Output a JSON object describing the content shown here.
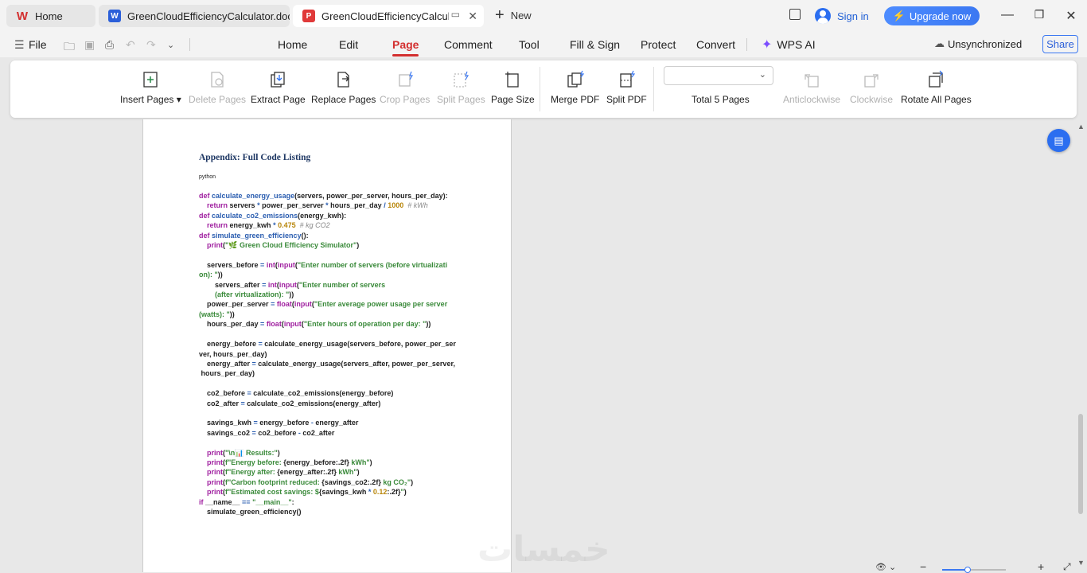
{
  "tabs": [
    {
      "label": "Home",
      "icon": "wps-logo-icon",
      "color": "#d32f2f"
    },
    {
      "label": "GreenCloudEfficiencyCalculator.doc",
      "icon": "word-doc-icon",
      "color": "#2b5fd9"
    },
    {
      "label": "GreenCloudEfficiencyCalcula",
      "icon": "pdf-doc-icon",
      "color": "#e03a3a"
    }
  ],
  "new_tab_label": "New",
  "sign_in_label": "Sign in",
  "upgrade_label": "Upgrade now",
  "menu": {
    "file": "File",
    "items": [
      "Home",
      "Edit",
      "Page",
      "Comment",
      "Tool",
      "Fill & Sign",
      "Protect",
      "Convert"
    ],
    "active": "Page",
    "wps_ai": "WPS AI",
    "sync_status": "Unsynchronized",
    "share": "Share"
  },
  "ribbon": {
    "insert_pages": "Insert Pages",
    "delete_pages": "Delete Pages",
    "extract_page": "Extract Page",
    "replace_pages": "Replace Pages",
    "crop_pages": "Crop Pages",
    "split_pages": "Split Pages",
    "page_size": "Page Size",
    "merge_pdf": "Merge PDF",
    "split_pdf": "Split PDF",
    "total_pages": "Total 5 Pages",
    "anticlockwise": "Anticlockwise",
    "clockwise": "Clockwise",
    "rotate_all": "Rotate All Pages"
  },
  "document": {
    "heading": "Appendix: Full Code Listing",
    "language_label": "python"
  },
  "colors": {
    "accent": "#d32f2f",
    "brand_blue": "#2b6ef0"
  }
}
